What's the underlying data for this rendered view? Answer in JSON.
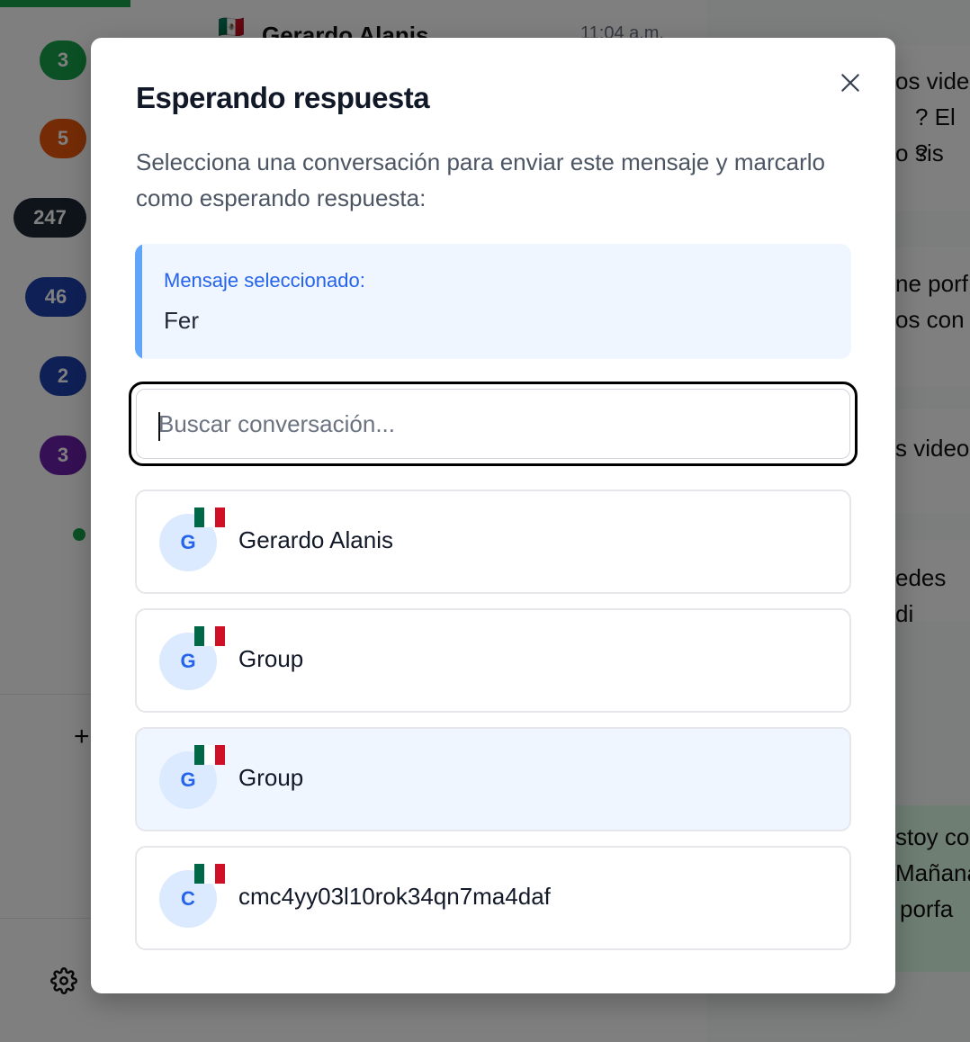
{
  "background": {
    "sidebar_badges": [
      "3",
      "5",
      "247",
      "46",
      "2",
      "3"
    ],
    "chatlist_header": {
      "name": "Gerardo Alanis",
      "time": "11:04 a.m."
    },
    "chat_fragments": [
      "os vide",
      "? El sis",
      "o ?",
      "ne porf",
      "os con",
      "s video",
      "edes di",
      "stoy co",
      "Mañana",
      "porfa"
    ]
  },
  "modal": {
    "title": "Esperando respuesta",
    "description": "Selecciona una conversación para enviar este mensaje y marcarlo como esperando respuesta:",
    "selected_label": "Mensaje seleccionado:",
    "selected_text": "Fer",
    "search_placeholder": "Buscar conversación...",
    "conversations": [
      {
        "initial": "G",
        "name": "Gerardo Alanis"
      },
      {
        "initial": "G",
        "name": "Group"
      },
      {
        "initial": "G",
        "name": "Group"
      },
      {
        "initial": "C",
        "name": "cmc4yy03l10rok34qn7ma4daf"
      }
    ],
    "active_conversation_index": 2
  },
  "colors": {
    "accent_blue": "#2563eb",
    "selected_bg": "#eff6ff",
    "accent_bar": "#60a5fa",
    "badge_green": "#16a34a",
    "badge_orange": "#ea580c",
    "badge_dark": "#1f2937",
    "badge_blue": "#1e40af",
    "badge_purple": "#6b21a8"
  },
  "icons": {
    "close": "close-icon",
    "settings": "gear-icon",
    "add": "plus-icon",
    "flag": "mexico-flag-icon"
  }
}
